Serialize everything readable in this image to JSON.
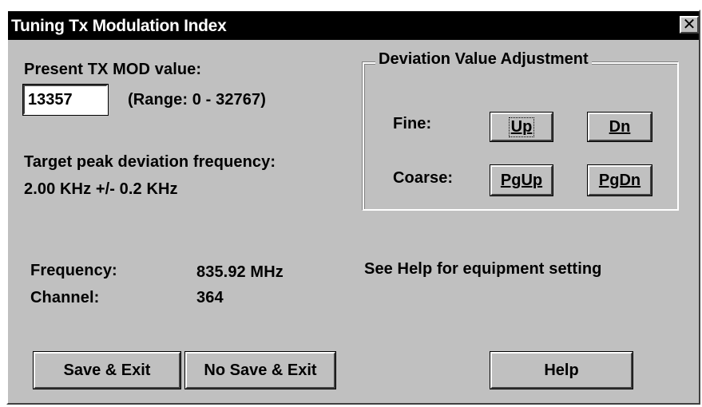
{
  "window": {
    "title": "Tuning Tx Modulation Index",
    "close_glyph": "✕"
  },
  "mod": {
    "label": "Present TX MOD value:",
    "value": "13357",
    "range": "(Range: 0 - 32767)"
  },
  "target": {
    "line1": "Target peak deviation frequency:",
    "line2": "2.00 KHz +/- 0.2 KHz"
  },
  "deviation": {
    "group_title": "Deviation Value Adjustment",
    "fine_label": "Fine:",
    "coarse_label": "Coarse:",
    "up": "Up",
    "dn": "Dn",
    "pgup": "PgUp",
    "pgdn": "PgDn"
  },
  "info": {
    "frequency_label": "Frequency:",
    "frequency_value": "835.92 MHz",
    "channel_label": "Channel:",
    "channel_value": "364",
    "help_note": "See Help for equipment setting"
  },
  "buttons": {
    "save_exit": "Save & Exit",
    "no_save_exit": "No Save & Exit",
    "help": "Help"
  },
  "colors": {
    "face": "#c0c0c0",
    "titlebar": "#000000",
    "title_text": "#ffffff"
  }
}
